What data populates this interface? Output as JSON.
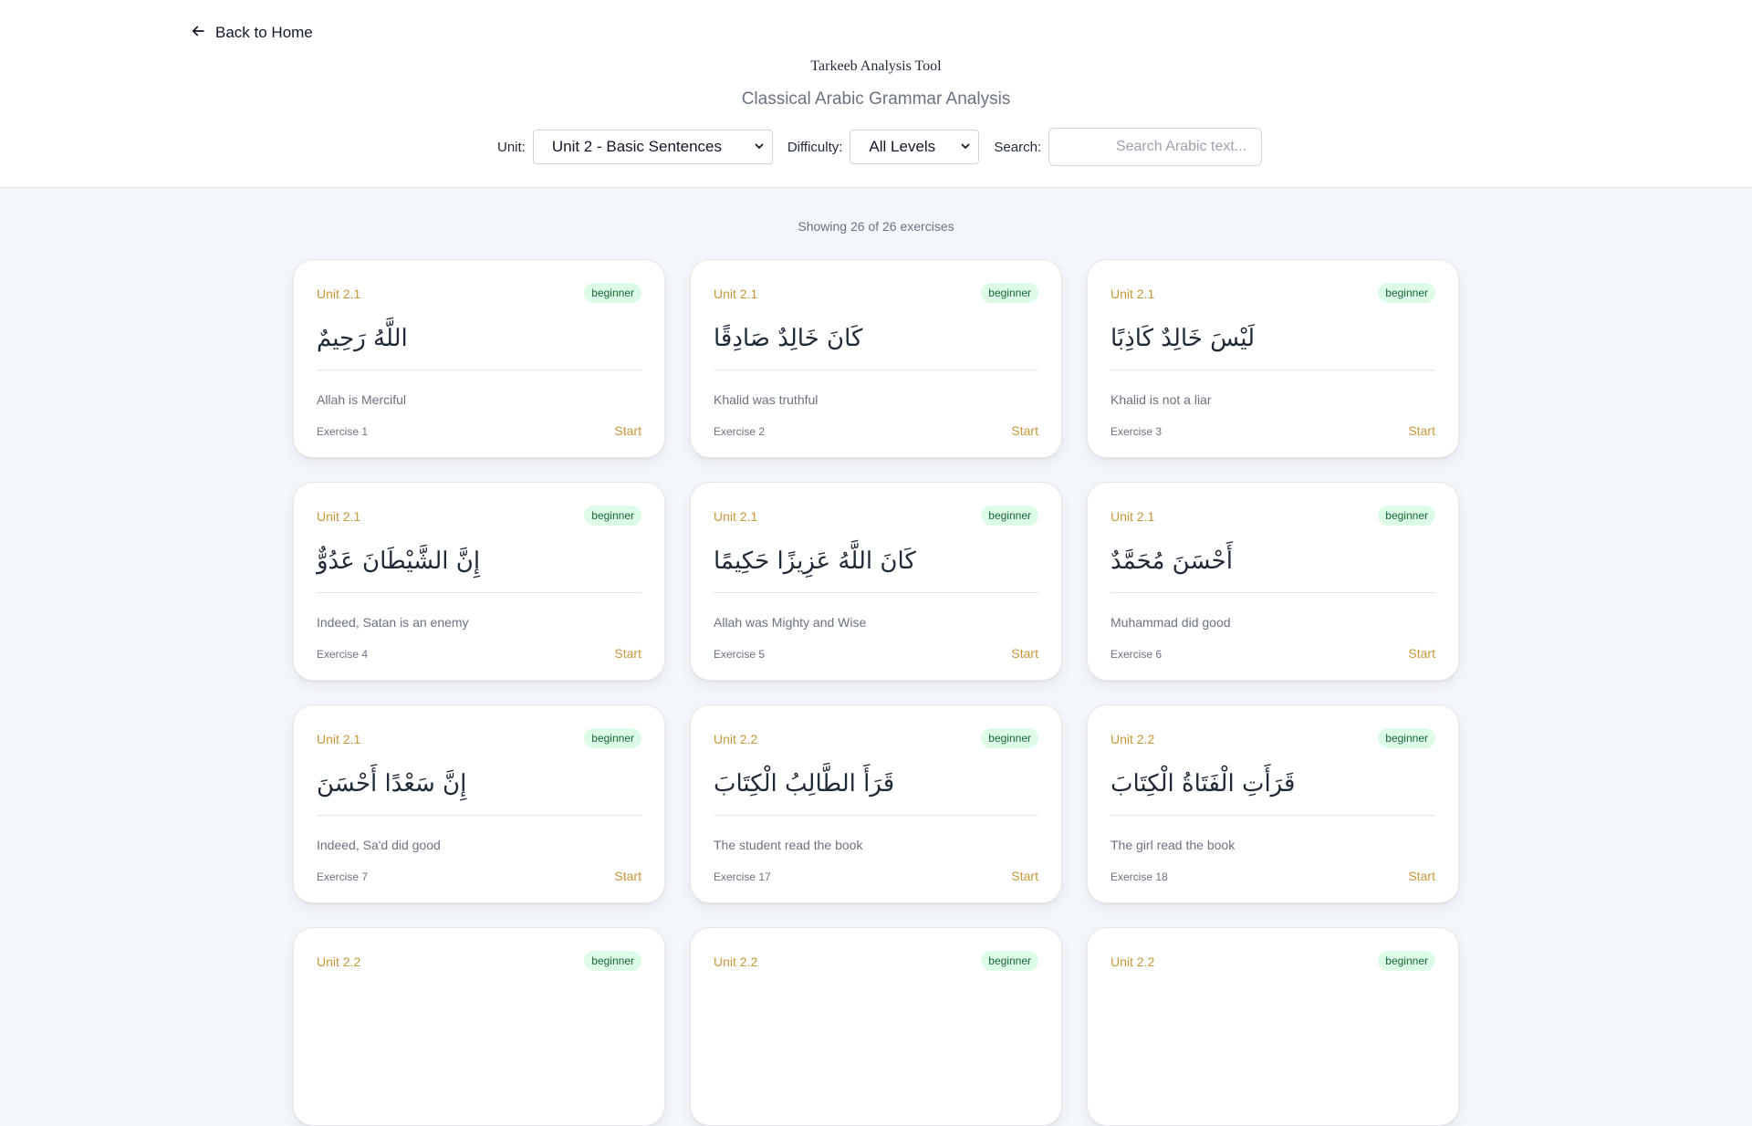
{
  "nav": {
    "back_label": "Back to Home"
  },
  "header": {
    "title": "Tarkeeb Analysis Tool",
    "subtitle": "Classical Arabic Grammar Analysis"
  },
  "filters": {
    "unit_label": "Unit:",
    "unit_value": "Unit 2 - Basic Sentences",
    "difficulty_label": "Difficulty:",
    "difficulty_value": "All Levels",
    "search_label": "Search:",
    "search_placeholder": "Search Arabic text...",
    "search_value": ""
  },
  "summary": {
    "count_text": "Showing 26 of 26 exercises"
  },
  "colors": {
    "accent": "#c9973a",
    "badge_bg": "#dcfce7",
    "badge_text": "#166534"
  },
  "cards": [
    {
      "unit": "Unit 2.1",
      "level": "beginner",
      "arabic": "اللَّهُ رَحِيمٌ",
      "translation": "Allah is Merciful",
      "exercise": "Exercise 1",
      "action": "Start"
    },
    {
      "unit": "Unit 2.1",
      "level": "beginner",
      "arabic": "كَانَ خَالِدٌ صَادِقًا",
      "translation": "Khalid was truthful",
      "exercise": "Exercise 2",
      "action": "Start"
    },
    {
      "unit": "Unit 2.1",
      "level": "beginner",
      "arabic": "لَيْسَ خَالِدٌ كَاذِبًا",
      "translation": "Khalid is not a liar",
      "exercise": "Exercise 3",
      "action": "Start"
    },
    {
      "unit": "Unit 2.1",
      "level": "beginner",
      "arabic": "إِنَّ الشَّيْطَانَ عَدُوٌّ",
      "translation": "Indeed, Satan is an enemy",
      "exercise": "Exercise 4",
      "action": "Start"
    },
    {
      "unit": "Unit 2.1",
      "level": "beginner",
      "arabic": "كَانَ اللَّهُ عَزِيزًا حَكِيمًا",
      "translation": "Allah was Mighty and Wise",
      "exercise": "Exercise 5",
      "action": "Start"
    },
    {
      "unit": "Unit 2.1",
      "level": "beginner",
      "arabic": "أَحْسَنَ مُحَمَّدٌ",
      "translation": "Muhammad did good",
      "exercise": "Exercise 6",
      "action": "Start"
    },
    {
      "unit": "Unit 2.1",
      "level": "beginner",
      "arabic": "إِنَّ سَعْدًا أَحْسَنَ",
      "translation": "Indeed, Sa'd did good",
      "exercise": "Exercise 7",
      "action": "Start"
    },
    {
      "unit": "Unit 2.2",
      "level": "beginner",
      "arabic": "قَرَأَ الطَّالِبُ الْكِتَابَ",
      "translation": "The student read the book",
      "exercise": "Exercise 17",
      "action": "Start"
    },
    {
      "unit": "Unit 2.2",
      "level": "beginner",
      "arabic": "قَرَأَتِ الْفَتَاةُ الْكِتَابَ",
      "translation": "The girl read the book",
      "exercise": "Exercise 18",
      "action": "Start"
    },
    {
      "unit": "Unit 2.2",
      "level": "beginner"
    },
    {
      "unit": "Unit 2.2",
      "level": "beginner"
    },
    {
      "unit": "Unit 2.2",
      "level": "beginner"
    }
  ]
}
